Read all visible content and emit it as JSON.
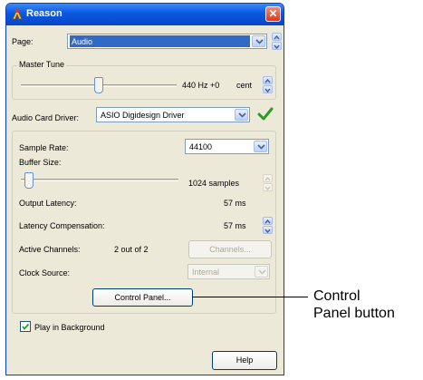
{
  "window": {
    "title": "Reason",
    "close_glyph": "✕"
  },
  "page": {
    "label": "Page:",
    "value": "Audio"
  },
  "master_tune": {
    "group_label": "Master Tune",
    "hz_text": "440 Hz +0",
    "unit": "cent"
  },
  "driver": {
    "label": "Audio Card Driver:",
    "value": "ASIO Digidesign Driver"
  },
  "audio": {
    "sample_rate_label": "Sample Rate:",
    "sample_rate_value": "44100",
    "buffer_size_label": "Buffer Size:",
    "buffer_size_value": "1024 samples",
    "output_latency_label": "Output Latency:",
    "output_latency_value": "57 ms",
    "latency_comp_label": "Latency Compensation:",
    "latency_comp_value": "57 ms",
    "active_channels_label": "Active Channels:",
    "active_channels_value": "2 out of 2",
    "channels_button": "Channels...",
    "clock_source_label": "Clock Source:",
    "clock_source_value": "Internal",
    "control_panel_button": "Control Panel..."
  },
  "play_in_background": {
    "label": "Play in Background",
    "checked": true
  },
  "help_button": "Help",
  "callout": {
    "text_line1": "Control",
    "text_line2": "Panel button"
  },
  "colors": {
    "titlebar": "#0a58e0",
    "selection": "#316ac5",
    "checkmark_green": "#2b9a2b",
    "dialog_bg": "#ece9d8"
  },
  "icons": {
    "app": "reason-app-icon",
    "close": "close-icon",
    "dropdown": "chevron-down-icon",
    "spinner": "spinner-icon",
    "status": "checkmark-icon"
  }
}
